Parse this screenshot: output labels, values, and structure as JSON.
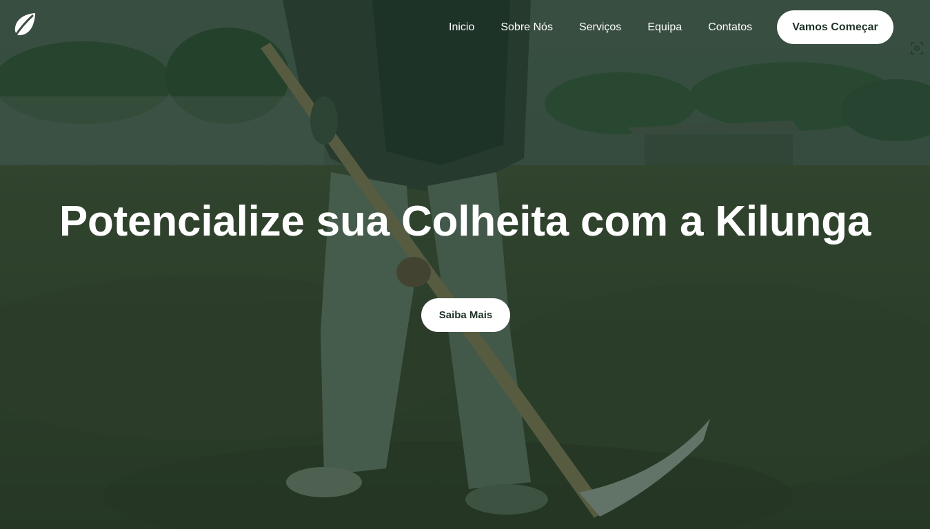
{
  "brand": {
    "logo_icon": "leaf-icon"
  },
  "nav": {
    "items": [
      {
        "label": "Inicio"
      },
      {
        "label": "Sobre Nós"
      },
      {
        "label": "Serviços"
      },
      {
        "label": "Equipa"
      },
      {
        "label": "Contatos"
      }
    ],
    "cta_label": "Vamos Começar"
  },
  "hero": {
    "title": "Potencialize sua Colheita com a Kilunga",
    "button_label": "Saiba Mais",
    "background_icon": "farmer-with-hoe-photo"
  },
  "colors": {
    "overlay": "#163a26",
    "button_bg": "#ffffff",
    "button_text": "#1d3526",
    "text": "#ffffff"
  }
}
